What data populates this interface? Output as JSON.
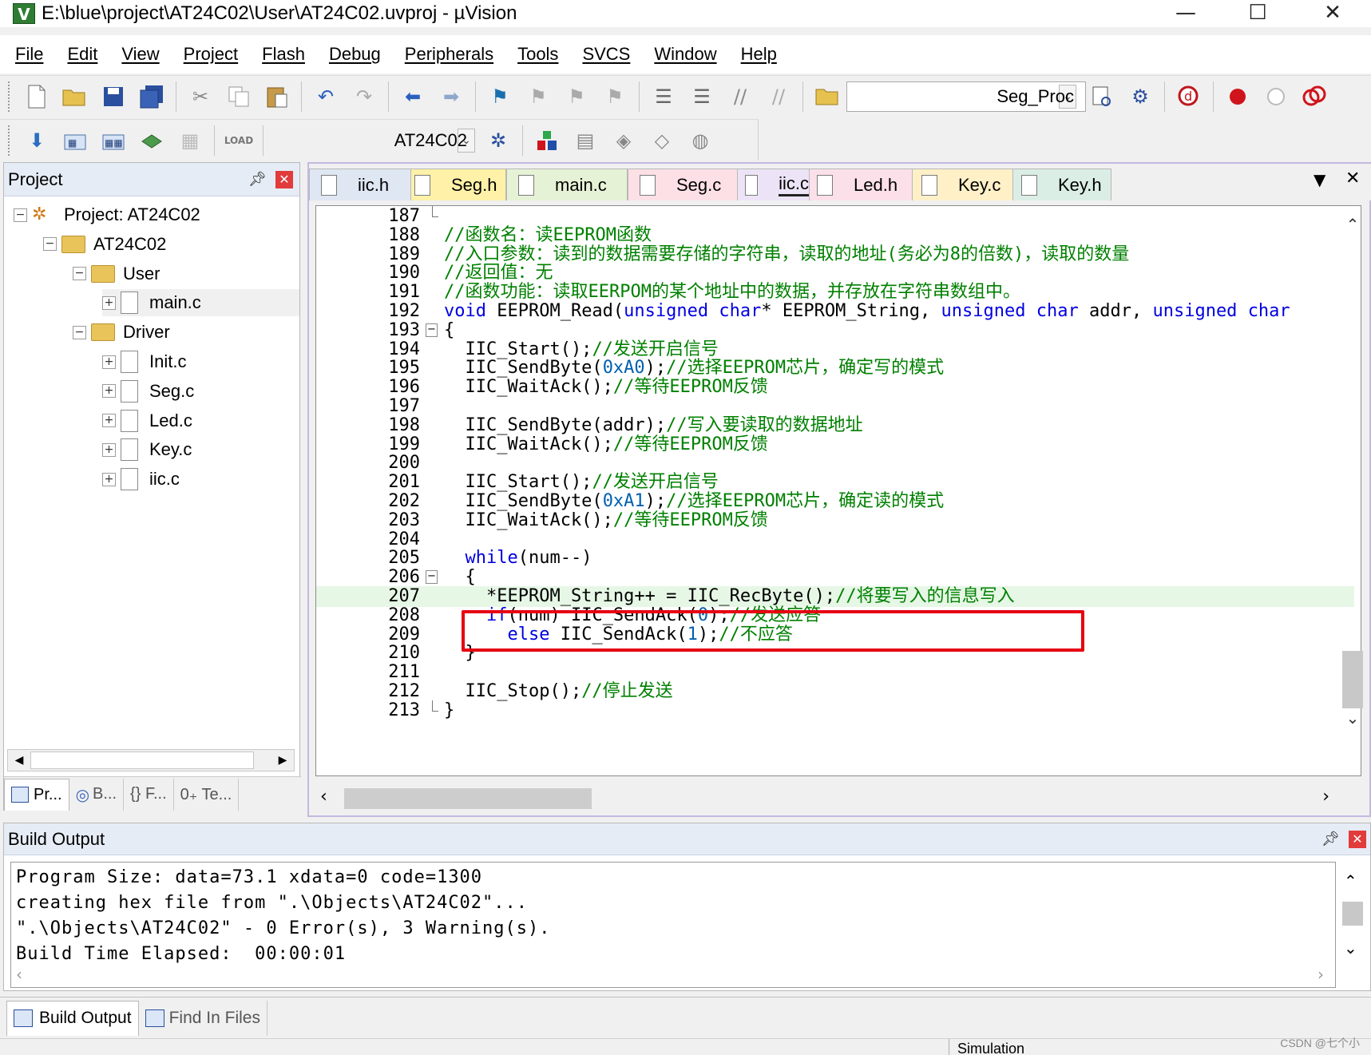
{
  "window": {
    "title": "E:\\blue\\project\\AT24C02\\User\\AT24C02.uvproj - µVision",
    "app_icon": "V",
    "controls": {
      "minimize": "—",
      "maximize": "☐",
      "close": "✕"
    }
  },
  "menu": [
    "File",
    "Edit",
    "View",
    "Project",
    "Flash",
    "Debug",
    "Peripherals",
    "Tools",
    "SVCS",
    "Window",
    "Help"
  ],
  "toolbar": {
    "function_combo": "Seg_Proc",
    "target_combo": "AT24C02",
    "icons_row1": [
      "new-file-icon",
      "open-file-icon",
      "save-icon",
      "save-all-icon",
      "cut-icon",
      "copy-icon",
      "paste-icon",
      "undo-icon",
      "redo-icon",
      "nav-back-icon",
      "nav-forward-icon",
      "bookmark-icon",
      "bookmark-prev-icon",
      "bookmark-next-icon",
      "bookmark-clear-icon",
      "indent-icon",
      "unindent-icon",
      "comment-icon",
      "uncomment-icon",
      "find-in-files-icon"
    ],
    "icons_row2": [
      "translate-icon",
      "build-icon",
      "rebuild-icon",
      "batch-build-icon",
      "stop-build-icon",
      "load-icon",
      "options-icon",
      "manage-components-icon",
      "pack-installer-icon",
      "select-device-icon",
      "event-recorder-icon"
    ]
  },
  "project_panel": {
    "title": "Project",
    "tree": [
      {
        "label": "Project: AT24C02",
        "level": 0,
        "type": "project",
        "toggle": "−"
      },
      {
        "label": "AT24C02",
        "level": 1,
        "type": "target",
        "toggle": "−"
      },
      {
        "label": "User",
        "level": 2,
        "type": "folder",
        "toggle": "−"
      },
      {
        "label": "main.c",
        "level": 3,
        "type": "file",
        "toggle": "+",
        "selected": true
      },
      {
        "label": "Driver",
        "level": 2,
        "type": "folder",
        "toggle": "−"
      },
      {
        "label": "Init.c",
        "level": 3,
        "type": "file",
        "toggle": "+"
      },
      {
        "label": "Seg.c",
        "level": 3,
        "type": "file",
        "toggle": "+"
      },
      {
        "label": "Led.c",
        "level": 3,
        "type": "file",
        "toggle": "+"
      },
      {
        "label": "Key.c",
        "level": 3,
        "type": "file",
        "toggle": "+"
      },
      {
        "label": "iic.c",
        "level": 3,
        "type": "file",
        "toggle": "+"
      }
    ],
    "bottom_tabs": [
      "Pr...",
      "B...",
      "{} F...",
      "0₊ Te..."
    ]
  },
  "editor": {
    "tabs": [
      {
        "label": "iic.h",
        "color": "#dfe7f3"
      },
      {
        "label": "Seg.h",
        "color": "#fff1a8"
      },
      {
        "label": "main.c",
        "color": "#e6f2d6"
      },
      {
        "label": "Seg.c",
        "color": "#fde0e6"
      },
      {
        "label": "iic.c",
        "color": "#ece4f6",
        "active": true
      },
      {
        "label": "Led.h",
        "color": "#fbe0ea"
      },
      {
        "label": "Key.c",
        "color": "#fff0c8"
      },
      {
        "label": "Key.h",
        "color": "#dbeee6"
      }
    ],
    "lines": [
      {
        "n": "187",
        "fold": "end",
        "segs": [
          [
            "",
            ""
          ]
        ]
      },
      {
        "n": "188",
        "segs": [
          [
            "//函数名：读EEPROM函数",
            "cm"
          ]
        ]
      },
      {
        "n": "189",
        "segs": [
          [
            "//入口参数：读到的数据需要存储的字符串，读取的地址(务必为8的倍数)，读取的数量",
            "cm"
          ]
        ]
      },
      {
        "n": "190",
        "segs": [
          [
            "//返回值：无",
            "cm"
          ]
        ]
      },
      {
        "n": "191",
        "segs": [
          [
            "//函数功能：读取EERPOM的某个地址中的数据，并存放在字符串数组中。",
            "cm"
          ]
        ]
      },
      {
        "n": "192",
        "segs": [
          [
            "void",
            "kw"
          ],
          [
            " EEPROM_Read(",
            ""
          ],
          [
            "unsigned",
            "kw"
          ],
          [
            " ",
            ""
          ],
          [
            "char",
            "kw"
          ],
          [
            "* EEPROM_String, ",
            ""
          ],
          [
            "unsigned",
            "kw"
          ],
          [
            " ",
            ""
          ],
          [
            "char",
            "kw"
          ],
          [
            " addr, ",
            ""
          ],
          [
            "unsigned",
            "kw"
          ],
          [
            " ",
            ""
          ],
          [
            "char",
            "kw"
          ]
        ]
      },
      {
        "n": "193",
        "fold": "open",
        "segs": [
          [
            "{",
            ""
          ]
        ]
      },
      {
        "n": "194",
        "segs": [
          [
            "  IIC_Start();",
            ""
          ],
          [
            "//发送开启信号",
            "cm"
          ]
        ]
      },
      {
        "n": "195",
        "segs": [
          [
            "  IIC_SendByte(",
            ""
          ],
          [
            "0xA0",
            "num"
          ],
          [
            ");",
            ""
          ],
          [
            "//选择EEPROM芯片，确定写的模式",
            "cm"
          ]
        ]
      },
      {
        "n": "196",
        "segs": [
          [
            "  IIC_WaitAck();",
            ""
          ],
          [
            "//等待EEPROM反馈",
            "cm"
          ]
        ]
      },
      {
        "n": "197",
        "segs": [
          [
            "",
            ""
          ]
        ]
      },
      {
        "n": "198",
        "segs": [
          [
            "  IIC_SendByte(addr);",
            ""
          ],
          [
            "//写入要读取的数据地址",
            "cm"
          ]
        ]
      },
      {
        "n": "199",
        "segs": [
          [
            "  IIC_WaitAck();",
            ""
          ],
          [
            "//等待EEPROM反馈",
            "cm"
          ]
        ]
      },
      {
        "n": "200",
        "segs": [
          [
            "",
            ""
          ]
        ]
      },
      {
        "n": "201",
        "segs": [
          [
            "  IIC_Start();",
            ""
          ],
          [
            "//发送开启信号",
            "cm"
          ]
        ]
      },
      {
        "n": "202",
        "segs": [
          [
            "  IIC_SendByte(",
            ""
          ],
          [
            "0xA1",
            "num"
          ],
          [
            ");",
            ""
          ],
          [
            "//选择EEPROM芯片，确定读的模式",
            "cm"
          ]
        ]
      },
      {
        "n": "203",
        "segs": [
          [
            "  IIC_WaitAck();",
            ""
          ],
          [
            "//等待EEPROM反馈",
            "cm"
          ]
        ]
      },
      {
        "n": "204",
        "segs": [
          [
            "",
            ""
          ]
        ]
      },
      {
        "n": "205",
        "segs": [
          [
            "  ",
            ""
          ],
          [
            "while",
            "kw"
          ],
          [
            "(num--)",
            ""
          ]
        ]
      },
      {
        "n": "206",
        "fold": "open",
        "segs": [
          [
            "  {",
            ""
          ]
        ]
      },
      {
        "n": "207",
        "highlight": true,
        "segs": [
          [
            "    *EEPROM_String++ = IIC_RecByte();",
            ""
          ],
          [
            "//将要写入的信息写入",
            "cm"
          ]
        ]
      },
      {
        "n": "208",
        "segs": [
          [
            "    ",
            ""
          ],
          [
            "if",
            "kw"
          ],
          [
            "(num) IIC_SendAck(",
            ""
          ],
          [
            "0",
            "num"
          ],
          [
            ");",
            ""
          ],
          [
            "//发送应答",
            "cm"
          ]
        ]
      },
      {
        "n": "209",
        "segs": [
          [
            "      ",
            ""
          ],
          [
            "else",
            "kw"
          ],
          [
            " IIC_SendAck(",
            ""
          ],
          [
            "1",
            "num"
          ],
          [
            ");",
            ""
          ],
          [
            "//不应答",
            "cm"
          ]
        ]
      },
      {
        "n": "210",
        "segs": [
          [
            "  }",
            ""
          ]
        ]
      },
      {
        "n": "211",
        "segs": [
          [
            "",
            ""
          ]
        ]
      },
      {
        "n": "212",
        "segs": [
          [
            "  IIC_Stop();",
            ""
          ],
          [
            "//停止发送",
            "cm"
          ]
        ]
      },
      {
        "n": "213",
        "fold": "end",
        "segs": [
          [
            "}",
            ""
          ]
        ]
      }
    ]
  },
  "build_output": {
    "title": "Build Output",
    "lines": [
      "Program Size: data=73.1 xdata=0 code=1300",
      "creating hex file from \".\\Objects\\AT24C02\"...",
      "\".\\Objects\\AT24C02\" - 0 Error(s), 3 Warning(s).",
      "Build Time Elapsed:  00:00:01"
    ],
    "tabs": [
      "Build Output",
      "Find In Files"
    ]
  },
  "status": {
    "mode": "Simulation"
  },
  "watermark": "CSDN @七个小"
}
